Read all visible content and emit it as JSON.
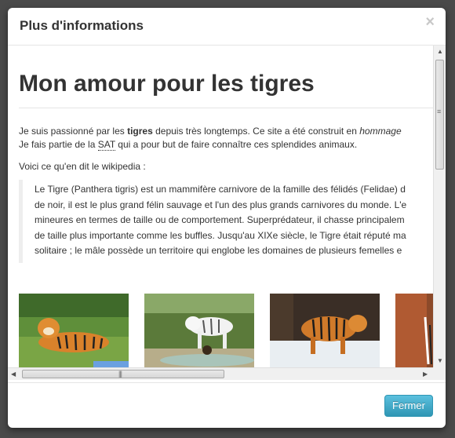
{
  "modal": {
    "title": "Plus d'informations",
    "close_glyph": "×",
    "footer_button": "Fermer"
  },
  "page": {
    "heading": "Mon amour pour les tigres",
    "intro": {
      "before_bold": "Je suis passionné par les ",
      "bold": "tigres",
      "after_bold": " depuis très longtemps. Ce site a été construit en ",
      "italic": "hommage",
      "line2_before": "Je fais partie de la ",
      "abbr": "SAT",
      "line2_after": " qui a pour but de faire connaître ces splendides animaux."
    },
    "wiki_intro": "Voici ce qu'en dit le wikipedia :",
    "quote_lines": [
      "Le Tigre (Panthera tigris) est un mammifère carnivore de la famille des félidés (Felidae) d",
      "de noir, il est le plus grand félin sauvage et l'un des plus grands carnivores du monde. L'e",
      "mineures en termes de taille ou de comportement. Superprédateur, il chasse principalem",
      "de taille plus importante comme les buffles. Jusqu'au XIXe siècle, le Tigre était réputé ma",
      "solitaire ; le mâle possède un territoire qui englobe les domaines de plusieurs femelles e"
    ],
    "thumbnails": [
      "tiger-lying-on-grass",
      "white-tiger-by-water",
      "tiger-walking-in-snow",
      "tiger-partial"
    ]
  },
  "colors": {
    "accent": "#49afcd",
    "text": "#333333",
    "close_glyph": "#c8c8c8"
  },
  "icons": {
    "close": "close-icon",
    "arrow_up": "arrow-up-icon",
    "arrow_down": "arrow-down-icon",
    "arrow_left": "arrow-left-icon",
    "arrow_right": "arrow-right-icon"
  }
}
